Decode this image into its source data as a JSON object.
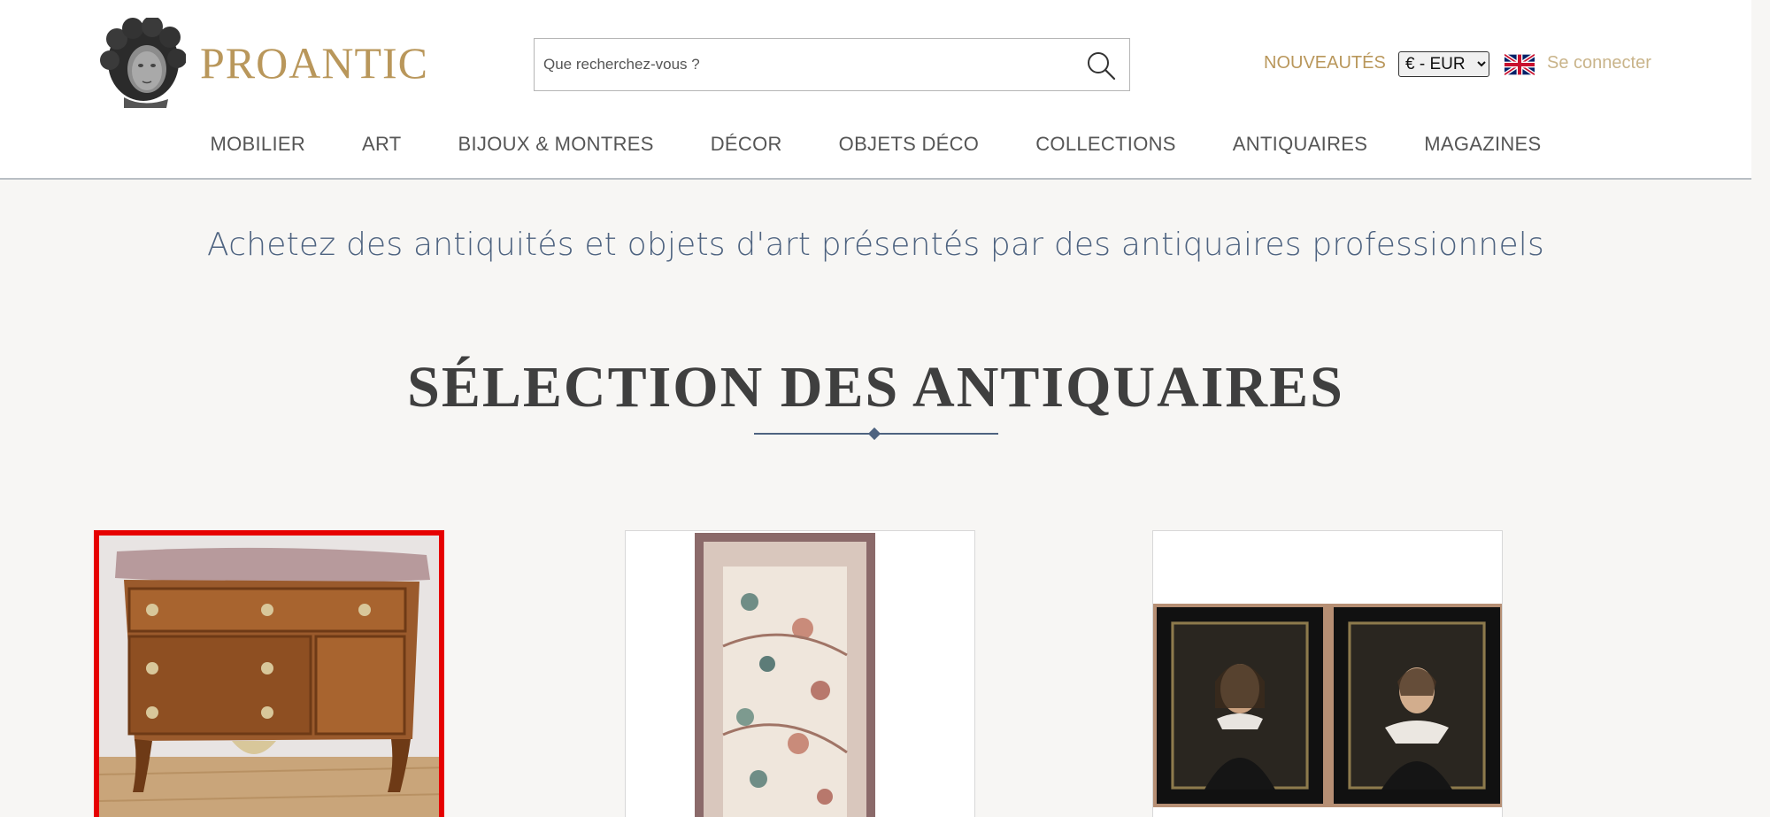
{
  "brand": {
    "name": "PROANTIC"
  },
  "search": {
    "placeholder": "Que recherchez-vous ?"
  },
  "header": {
    "nouveautes_label": "NOUVEAUTÉS",
    "currency": {
      "selected": "€ - EUR",
      "options": [
        "€ - EUR"
      ]
    },
    "language_flag": "uk-flag-icon",
    "login_label": "Se connecter"
  },
  "nav": {
    "items": [
      {
        "label": "MOBILIER"
      },
      {
        "label": "ART"
      },
      {
        "label": "BIJOUX & MONTRES"
      },
      {
        "label": "DÉCOR"
      },
      {
        "label": "OBJETS DÉCO"
      },
      {
        "label": "COLLECTIONS"
      },
      {
        "label": "ANTIQUAIRES"
      },
      {
        "label": "MAGAZINES"
      }
    ]
  },
  "main": {
    "tagline": "Achetez des antiquités et objets d'art présentés par des antiquaires professionnels",
    "section_title": "SÉLECTION DES ANTIQUAIRES",
    "cards": [
      {
        "image": "marquetry-commode",
        "selected": true
      },
      {
        "image": "persian-rug",
        "selected": false
      },
      {
        "image": "pair-of-portraits",
        "selected": false
      }
    ]
  },
  "colors": {
    "brand_gold": "#b9975b",
    "tagline_blue": "#4e6380",
    "selection_red": "#e60000",
    "background": "#f7f6f4"
  }
}
